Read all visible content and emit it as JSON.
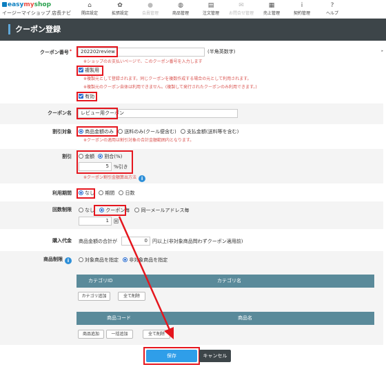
{
  "app": {
    "logo_brand": [
      "easy",
      "my",
      "shop"
    ],
    "logo_sub": "イージーマイショップ 店長ナビ"
  },
  "nav": [
    {
      "label": "開店設定",
      "icon": "home-icon",
      "glyph": "⌂",
      "dim": false
    },
    {
      "label": "拡張設定",
      "icon": "gear-icon",
      "glyph": "✿",
      "dim": false
    },
    {
      "label": "会員管理",
      "icon": "user-icon",
      "glyph": "●",
      "dim": true
    },
    {
      "label": "商品管理",
      "icon": "gift-icon",
      "glyph": "◍",
      "dim": false
    },
    {
      "label": "注文管理",
      "icon": "document-icon",
      "glyph": "▤",
      "dim": false
    },
    {
      "label": "お問合せ管理",
      "icon": "mail-icon",
      "glyph": "✉",
      "dim": true
    },
    {
      "label": "売上管理",
      "icon": "calculator-icon",
      "glyph": "▦",
      "dim": false
    },
    {
      "label": "契約管理",
      "icon": "info-icon",
      "glyph": "i",
      "dim": false
    },
    {
      "label": "ヘルプ",
      "icon": "help-icon",
      "glyph": "?",
      "dim": false
    }
  ],
  "page": {
    "title": "クーポン登録"
  },
  "form": {
    "coupon_code": {
      "label": "クーポン番号",
      "required_mark": "*",
      "value": "202202review",
      "hint": "(半角英数字)",
      "note": "※ショップのお支払いページで、このクーポン番号を入力します",
      "copy_label": "複製用",
      "copy_note1": "※複製元として登録されます。同じクーポンを複数作成する場合の元として利用されます。",
      "copy_note2": "※複製元のクーポン自体は利用できません。(複製して発行されたクーポンのみ利用できます。)",
      "enabled_label": "有効"
    },
    "coupon_name": {
      "label": "クーポン名",
      "value": "レビュー用クーポン"
    },
    "discount_target": {
      "label": "割引対象",
      "options": [
        "商品金額のみ",
        "送料のみ(クール便含む)",
        "支払金額(送料等を含む)"
      ],
      "note": "※クーポンの適用は割引対象の合計金額範囲内となります。"
    },
    "discount": {
      "label": "割引",
      "options": [
        "金額",
        "割合(%)"
      ],
      "value": "5",
      "unit": "%引き",
      "note": "※クーポン割引金額算出方法"
    },
    "period": {
      "label": "利用期間",
      "options": [
        "なし",
        "期間",
        "日数"
      ]
    },
    "usage_limit": {
      "label": "回数制限",
      "options": [
        "なし",
        "クーポン毎",
        "同一メールアドレス毎"
      ],
      "value": "1",
      "unit": "回"
    },
    "purchase_amount": {
      "label": "購入代金",
      "prefix": "商品金額の合計が",
      "value": "0",
      "suffix": "円以上(非対象商品問わずクーポン適用前)"
    },
    "product_limit": {
      "label": "商品制限",
      "options": [
        "対象商品を指定",
        "非対象商品を指定"
      ],
      "category_table": {
        "headers": [
          "カテゴリID",
          "カテゴリ名"
        ],
        "buttons": [
          "カテゴリ追加",
          "全て削除"
        ]
      },
      "product_table": {
        "headers": [
          "商品コード",
          "商品名"
        ],
        "buttons": [
          "商品追加",
          "一括追加",
          "全て削除"
        ]
      }
    }
  },
  "actions": {
    "save": "保存",
    "cancel": "キャンセル"
  },
  "colors": {
    "highlight": "#e5161e",
    "header_bg": "#3d4549",
    "primary": "#2f9ee9",
    "table_head": "#5a8a9a"
  }
}
